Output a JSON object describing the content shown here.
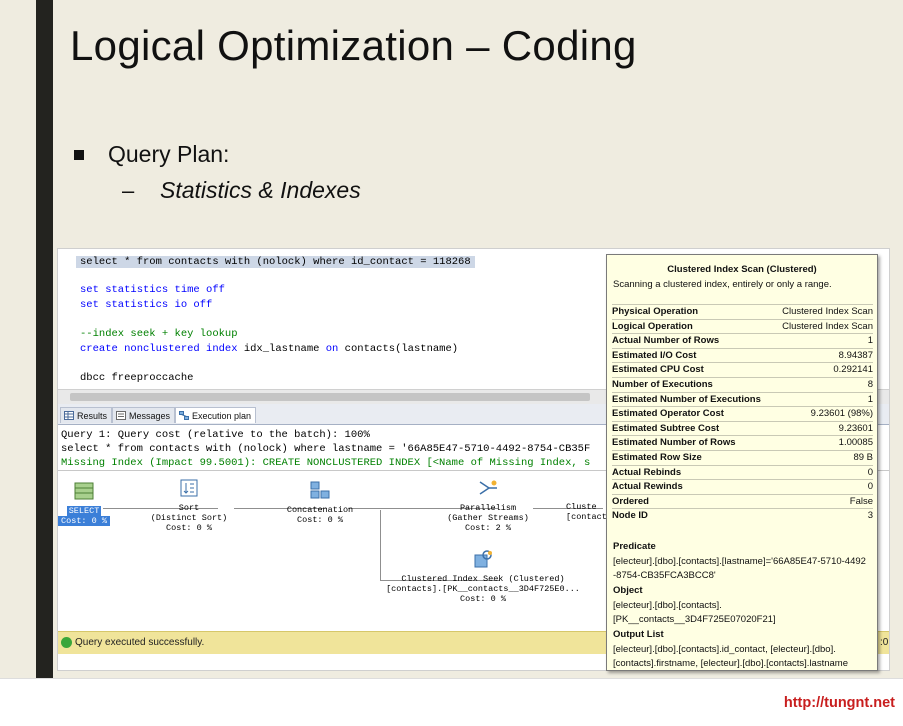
{
  "slide": {
    "title": "Logical Optimization – Coding",
    "bullet_1": "Query Plan:",
    "dash": "–",
    "bullet_2": "Statistics & Indexes",
    "footer_url": "http://tungnt.net"
  },
  "editor": {
    "line_0": "select * from contacts with (nolock) where id_contact = 118268",
    "line_1_kw": "set statistics time off",
    "line_2_kw": "set statistics io off",
    "line_3_comment": "--index seek + key lookup",
    "line_4_kw": "create nonclustered index",
    "line_4_rest": " idx_lastname ",
    "line_4_kw2": "on",
    "line_4_end": " contacts(lastname)",
    "line_5": "dbcc freeproccache"
  },
  "tabs": [
    {
      "label": "Results"
    },
    {
      "label": "Messages"
    },
    {
      "label": "Execution plan"
    }
  ],
  "results": {
    "query_cost": "Query 1: Query cost (relative to the batch): 100%",
    "query_text": "select * from contacts with (nolock) where lastname = '66A85E47-5710-4492-8754-CB35F",
    "missing_index": "Missing Index (Impact 99.5001): CREATE NONCLUSTERED INDEX [<Name of Missing Index, s"
  },
  "plan_nodes": {
    "select": {
      "name": "SELECT",
      "cost": "Cost: 0 %"
    },
    "sort": {
      "name": "Sort",
      "sub": "(Distinct Sort)",
      "cost": "Cost: 0 %"
    },
    "concat": {
      "name": "Concatenation",
      "cost": "Cost: 0 %"
    },
    "parallel": {
      "name": "Parallelism",
      "sub": "(Gather Streams)",
      "cost": "Cost: 2 %"
    },
    "cluster_partial": {
      "name": "Cluste",
      "sub": "[contact"
    },
    "seek": {
      "name": "Clustered Index Seek (Clustered)",
      "sub": "[contacts].[PK__contacts__3D4F725E0...",
      "cost": "Cost: 0 %"
    }
  },
  "status": {
    "text": "Query executed successfully.",
    "tail": ":0("
  },
  "tooltip": {
    "title": "Clustered Index Scan (Clustered)",
    "desc": "Scanning a clustered index, entirely or only a range.",
    "rows": [
      {
        "k": "Physical Operation",
        "v": "Clustered Index Scan"
      },
      {
        "k": "Logical Operation",
        "v": "Clustered Index Scan"
      },
      {
        "k": "Actual Number of Rows",
        "v": "1"
      },
      {
        "k": "Estimated I/O Cost",
        "v": "8.94387"
      },
      {
        "k": "Estimated CPU Cost",
        "v": "0.292141"
      },
      {
        "k": "Number of Executions",
        "v": "8"
      },
      {
        "k": "Estimated Number of Executions",
        "v": "1"
      },
      {
        "k": "Estimated Operator Cost",
        "v": "9.23601 (98%)"
      },
      {
        "k": "Estimated Subtree Cost",
        "v": "9.23601"
      },
      {
        "k": "Estimated Number of Rows",
        "v": "1.00085"
      },
      {
        "k": "Estimated Row Size",
        "v": "89 B"
      },
      {
        "k": "Actual Rebinds",
        "v": "0"
      },
      {
        "k": "Actual Rewinds",
        "v": "0"
      },
      {
        "k": "Ordered",
        "v": "False"
      },
      {
        "k": "Node ID",
        "v": "3"
      }
    ],
    "predicate_h": "Predicate",
    "predicate_1": "[electeur].[dbo].[contacts].[lastname]='66A85E47-5710-4492",
    "predicate_2": "-8754-CB35FCA3BCC8'",
    "object_h": "Object",
    "object_1": "[electeur].[dbo].[contacts].",
    "object_2": "[PK__contacts__3D4F725E07020F21]",
    "output_h": "Output List",
    "output_1": "[electeur].[dbo].[contacts].id_contact, [electeur].[dbo].",
    "output_2": "[contacts].firstname, [electeur].[dbo].[contacts].lastname"
  }
}
